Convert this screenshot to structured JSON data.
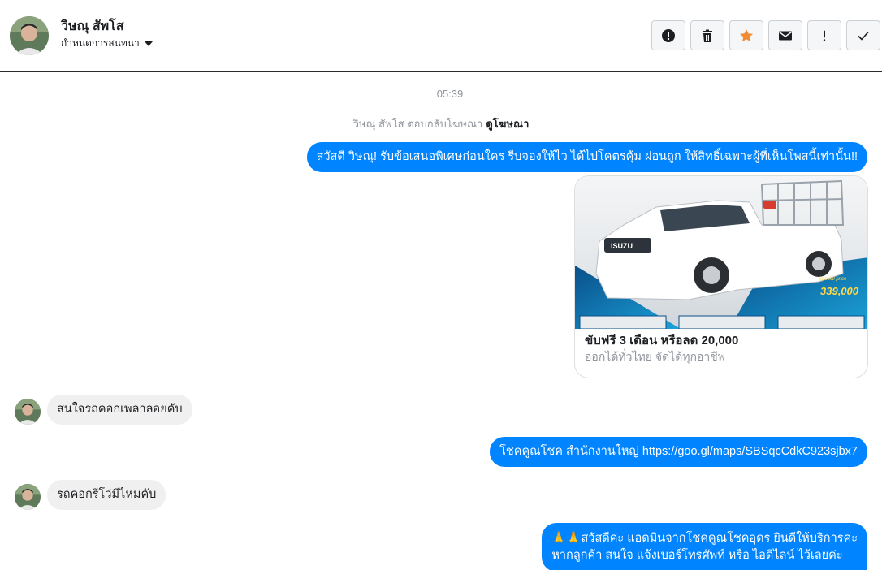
{
  "header": {
    "contact_name": "วิษณุ สัพโส",
    "sub_label": "กำหนดการสนทนา",
    "actions": [
      {
        "name": "report-button",
        "icon": "alert-circle-icon"
      },
      {
        "name": "delete-button",
        "icon": "trash-icon"
      },
      {
        "name": "star-button",
        "icon": "star-icon",
        "color": "#f28b31"
      },
      {
        "name": "mark-unread-button",
        "icon": "envelope-icon"
      },
      {
        "name": "important-button",
        "icon": "exclamation-icon"
      },
      {
        "name": "done-button",
        "icon": "check-icon"
      }
    ]
  },
  "conversation": {
    "timestamp": "05:39",
    "reply_note": "วิษณุ สัพโส ตอบกลับโฆษณา",
    "reply_link": "ดูโฆษณา",
    "messages": [
      {
        "direction": "out",
        "text": "สวัสดี วิษณุ! รับข้อเสนอพิเศษก่อนใคร รีบจองให้ไว ได้ไปโคตรคุ้ม ผ่อนถูก ให้สิทธิ์เฉพาะผู้ที่เห็นโพสนี้เท่านั้น!!"
      },
      {
        "direction": "out",
        "type": "card",
        "image_price": "339,000",
        "image_price_label": "Special price",
        "image_brand": "ISUZU",
        "title": "ขับฟรี 3 เดือน หรือลด 20,000",
        "subtitle": "ออกได้ทั่วไทย จัดได้ทุกอาชีพ"
      },
      {
        "direction": "in",
        "text": "สนใจรถคอกเพลาลอยคับ"
      },
      {
        "direction": "out",
        "text_prefix": "โชคคูณโชค สำนักงานใหญ่ ",
        "link": "https://goo.gl/maps/SBSqcCdkC923sjbx7"
      },
      {
        "direction": "in",
        "text": "รถคอกรีโว่มีไหมคับ"
      },
      {
        "direction": "out",
        "emoji": "🙏🙏",
        "line1": "สวัสดีค่ะ แอดมินจากโชคคูณโชคอุดร ยินดีให้บริการค่ะ",
        "line2": "หากลูกค้า สนใจ แจ้งเบอร์โทรศัพท์ หรือ ไอดีไลน์  ไว้เลยค่ะ"
      }
    ]
  },
  "colors": {
    "outgoing_bubble": "#0084ff",
    "incoming_bubble": "#f1f0f0",
    "star": "#f28b31"
  }
}
